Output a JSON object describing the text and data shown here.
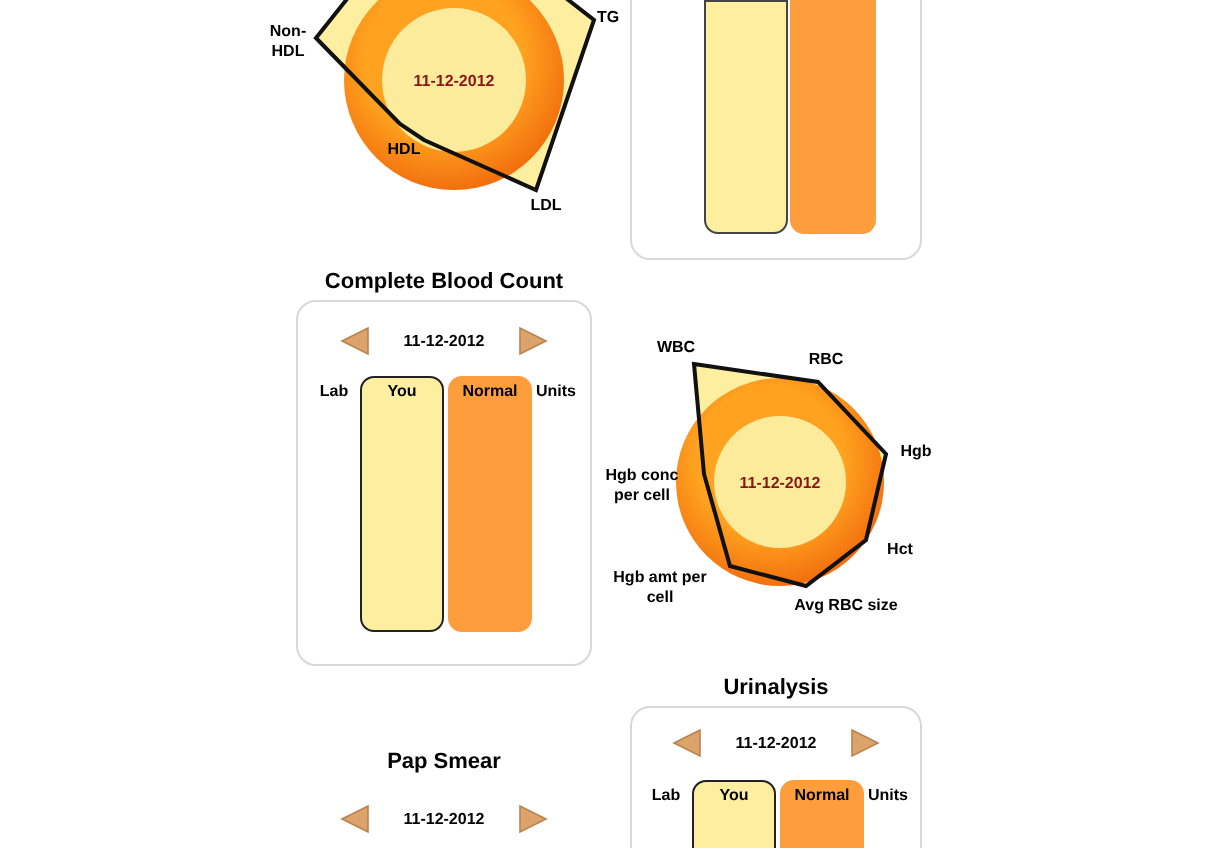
{
  "lipid_chart": {
    "date": "11-12-2012",
    "axes": [
      "Non-HDL",
      "TG",
      "LDL",
      "HDL"
    ]
  },
  "complete_blood_count": {
    "title": "Complete Blood Count",
    "date": "11-12-2012",
    "columns": [
      "Lab",
      "You",
      "Normal",
      "Units"
    ]
  },
  "cbc_chart": {
    "date": "11-12-2012",
    "axes": [
      "WBC",
      "RBC",
      "Hgb",
      "Hgb conc per cell",
      "Hct",
      "Hgb amt per cell",
      "Avg RBC size"
    ]
  },
  "pap_smear": {
    "title": "Pap Smear",
    "date": "11-12-2012"
  },
  "urinalysis": {
    "title": "Urinalysis",
    "date": "11-12-2012",
    "columns": [
      "Lab",
      "You",
      "Normal",
      "Units"
    ]
  }
}
